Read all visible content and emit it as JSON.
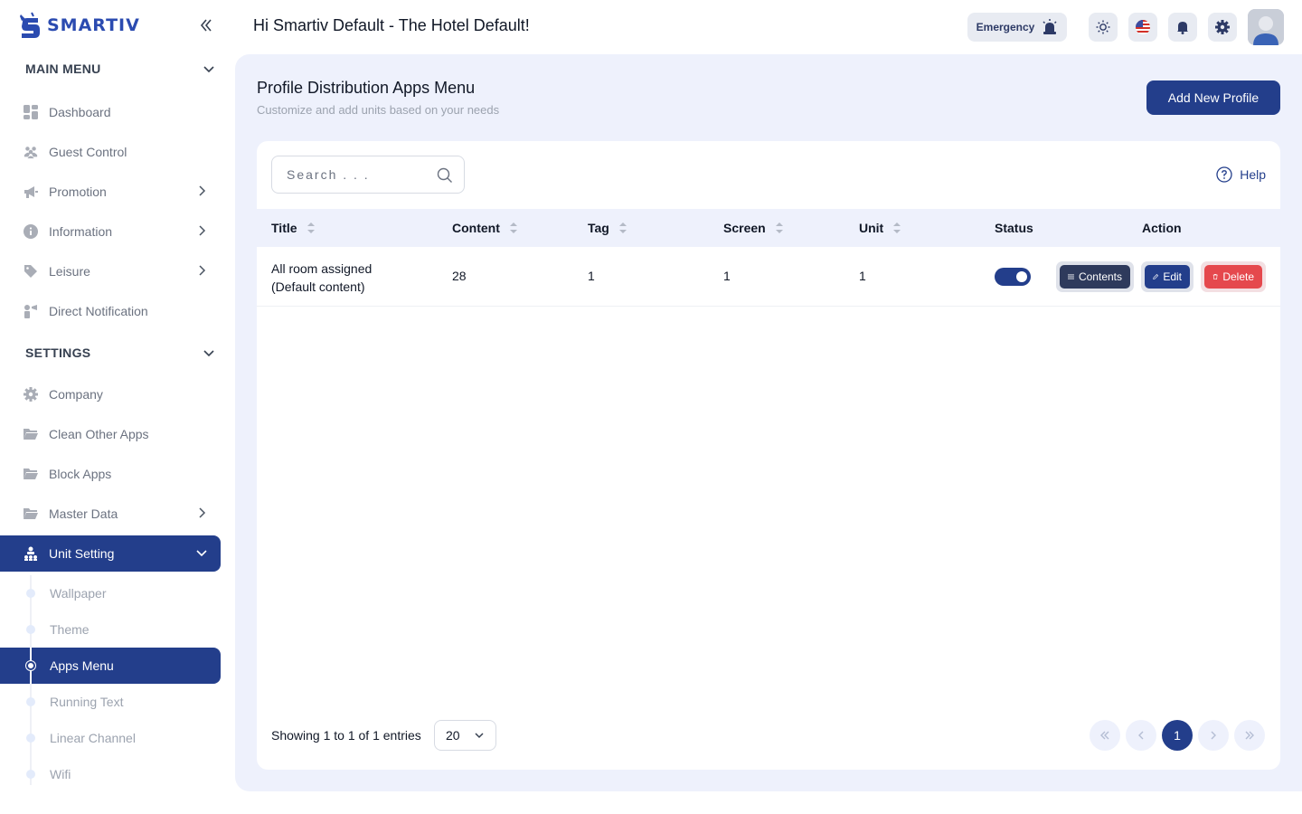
{
  "app": {
    "name": "SMARTIV"
  },
  "header": {
    "greeting": "Hi Smartiv Default - The Hotel Default!",
    "emergency_label": "Emergency"
  },
  "sidebar": {
    "main_menu_label": "MAIN MENU",
    "main_items": [
      {
        "label": "Dashboard",
        "icon": "dashboard-icon"
      },
      {
        "label": "Guest Control",
        "icon": "users-icon"
      },
      {
        "label": "Promotion",
        "icon": "megaphone-icon"
      },
      {
        "label": "Information",
        "icon": "info-icon"
      },
      {
        "label": "Leisure",
        "icon": "tag-icon"
      },
      {
        "label": "Direct Notification",
        "icon": "notification-icon"
      }
    ],
    "settings_label": "SETTINGS",
    "settings_items": [
      {
        "label": "Company",
        "icon": "gear-icon"
      },
      {
        "label": "Clean Other Apps",
        "icon": "folder-icon"
      },
      {
        "label": "Block Apps",
        "icon": "folder-icon"
      },
      {
        "label": "Master Data",
        "icon": "folder-icon"
      },
      {
        "label": "Unit Setting",
        "icon": "sitemap-icon"
      }
    ],
    "unit_setting_sub": [
      {
        "label": "Wallpaper"
      },
      {
        "label": "Theme"
      },
      {
        "label": "Apps Menu"
      },
      {
        "label": "Running Text"
      },
      {
        "label": "Linear Channel"
      },
      {
        "label": "Wifi"
      }
    ]
  },
  "page": {
    "title": "Profile Distribution Apps Menu",
    "subtitle": "Customize and add units based on your needs",
    "add_button": "Add New Profile"
  },
  "table": {
    "search_placeholder": "Search . . .",
    "help_label": "Help",
    "columns": [
      "Title",
      "Content",
      "Tag",
      "Screen",
      "Unit",
      "Status",
      "Action"
    ],
    "rows": [
      {
        "title_line1": "All room assigned",
        "title_line2": "(Default content)",
        "content": "28",
        "tag": "1",
        "screen": "1",
        "unit": "1",
        "status_on": true
      }
    ],
    "actions": {
      "contents": "Contents",
      "edit": "Edit",
      "delete": "Delete"
    },
    "footer": "Showing 1 to 1 of 1 entries",
    "per_page": "20",
    "current_page": "1"
  },
  "colors": {
    "primary": "#233e8b",
    "danger": "#e5484d",
    "content_bg": "#eef1fc"
  }
}
